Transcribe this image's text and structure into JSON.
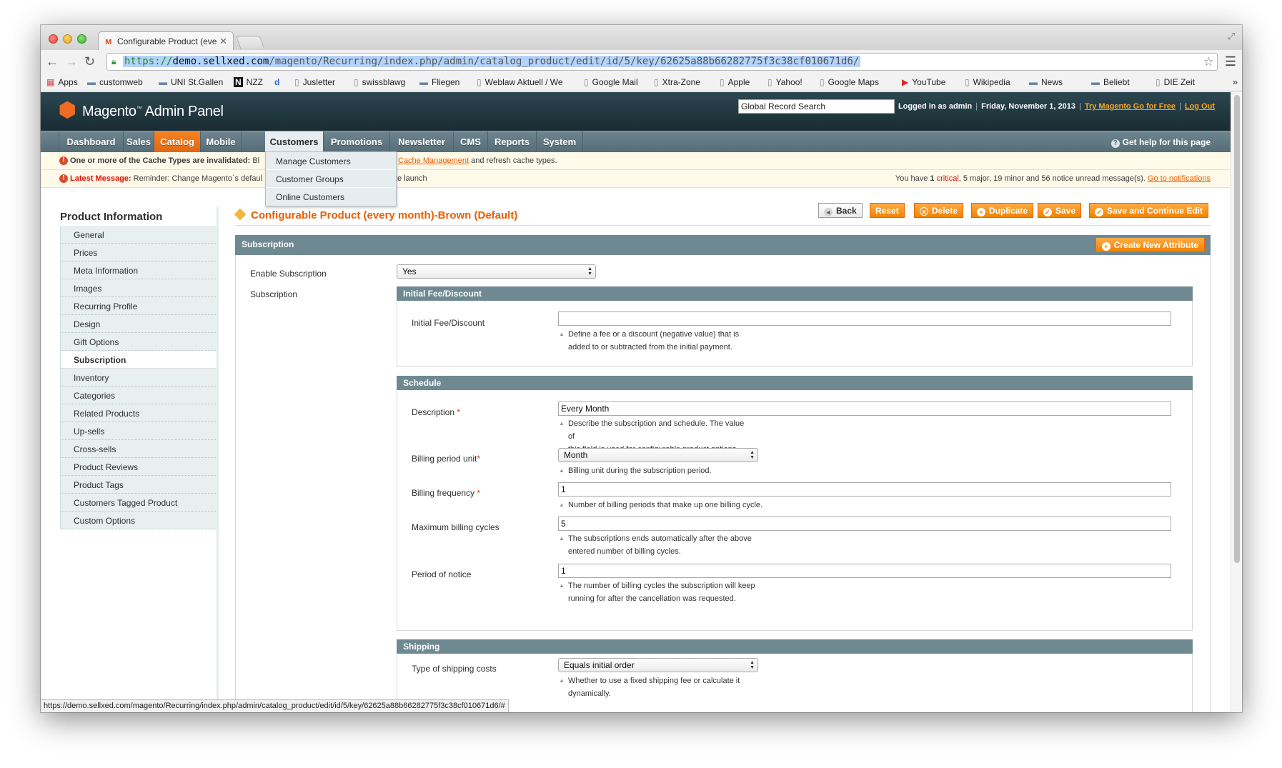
{
  "browser": {
    "tab_title": "Configurable Product (eve",
    "url_scheme": "https://",
    "url_host": "demo.sellxed.com",
    "url_path": "/magento/Recurring/index.php/admin/catalog_product/edit/id/5/key/62625a88b66282775f3c38cf010671d6/",
    "status_url": "https://demo.sellxed.com/magento/Recurring/index.php/admin/catalog_product/edit/id/5/key/62625a88b66282775f3c38cf010671d6/#",
    "bookmarks": [
      "Apps",
      "customweb",
      "UNI St.Gallen",
      "NZZ",
      "",
      "Jusletter",
      "swissblawg",
      "Fliegen",
      "Weblaw Aktuell / We",
      "Google Mail",
      "Xtra-Zone",
      "Apple",
      "Yahoo!",
      "Google Maps",
      "YouTube",
      "Wikipedia",
      "News",
      "Beliebt",
      "DIE Zeit"
    ]
  },
  "header": {
    "logo_text": "Magento",
    "logo_suffix": "Admin Panel",
    "search_value": "Global Record Search",
    "logged_in": "Logged in as admin",
    "date": "Friday, November 1, 2013",
    "try_link": "Try Magento Go for Free",
    "logout": "Log Out"
  },
  "nav": {
    "items": [
      "Dashboard",
      "Sales",
      "Catalog",
      "Mobile",
      "Customers",
      "Promotions",
      "Newsletter",
      "CMS",
      "Reports",
      "System"
    ],
    "help": "Get help for this page",
    "dropdown": [
      "Manage Customers",
      "Customer Groups",
      "Online Customers"
    ]
  },
  "notices": {
    "cache_bold": "One or more of the Cache Types are invalidated:",
    "cache_prefix": "Bl",
    "cache_link": "Cache Management",
    "cache_suffix": "and refresh cache types.",
    "latest_label": "Latest Message:",
    "latest_text": "Reminder: Change Magento`s defaul",
    "latest_tail": "te launch",
    "unread_1": "You have",
    "critical_count": "1",
    "critical_label": "critical",
    "major": ", 5 major, ",
    "minor": "19 minor and ",
    "notice_count": "56 notice unread message(s).",
    "goto": "Go to notifications"
  },
  "sidebar": {
    "title": "Product Information",
    "items": [
      "General",
      "Prices",
      "Meta Information",
      "Images",
      "Recurring Profile",
      "Design",
      "Gift Options",
      "Subscription",
      "Inventory",
      "Categories",
      "Related Products",
      "Up-sells",
      "Cross-sells",
      "Product Reviews",
      "Product Tags",
      "Customers Tagged Product",
      "Custom Options"
    ]
  },
  "content": {
    "title": "Configurable Product (every month)-Brown (Default)",
    "buttons": {
      "back": "Back",
      "reset": "Reset",
      "delete": "Delete",
      "duplicate": "Duplicate",
      "save": "Save",
      "save_continue": "Save and Continue Edit"
    },
    "section": "Subscription",
    "create_attr": "Create New Attribute",
    "enable_label": "Enable Subscription",
    "enable_value": "Yes",
    "subscription_label": "Subscription",
    "initial": {
      "head": "Initial Fee/Discount",
      "label": "Initial Fee/Discount",
      "value": "",
      "note1": "Define a fee or a discount (negative value) that is",
      "note2": "added to or subtracted from the initial payment."
    },
    "schedule": {
      "head": "Schedule",
      "desc_label": "Description",
      "desc_value": "Every Month",
      "desc_note1": "Describe the subscription and schedule. The value of",
      "desc_note2": "this field is used for configurable product options.",
      "unit_label": "Billing period unit",
      "unit_value": "Month",
      "unit_note": "Billing unit during the subscription period.",
      "freq_label": "Billing frequency",
      "freq_value": "1",
      "freq_note": "Number of billing periods that make up one billing cycle.",
      "max_label": "Maximum billing cycles",
      "max_value": "5",
      "max_note1": "The subscriptions ends automatically after the above",
      "max_note2": "entered number of billing cycles.",
      "notice_label": "Period of notice",
      "notice_value": "1",
      "notice_note1": "The number of billing cycles the subscription will keep",
      "notice_note2": "running for after the cancellation was requested."
    },
    "shipping": {
      "head": "Shipping",
      "type_label": "Type of shipping costs",
      "type_value": "Equals initial order",
      "type_note1": "Whether to use a fixed shipping fee or calculate it",
      "type_note2": "dynamically."
    }
  },
  "colors": {
    "accent": "#eb5e00",
    "header_bg": "#21363e",
    "section_bg": "#6f8992"
  }
}
